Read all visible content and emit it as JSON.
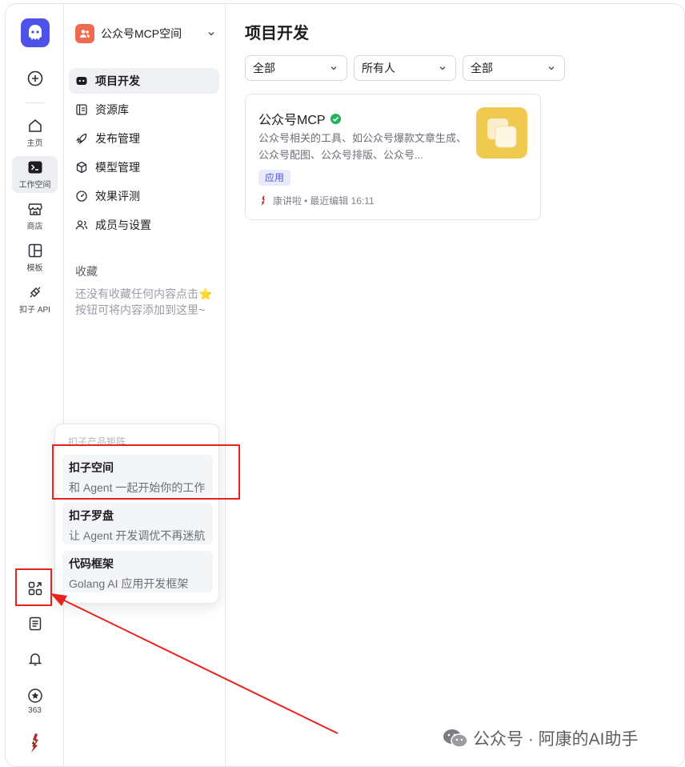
{
  "space": {
    "name": "公众号MCP空间"
  },
  "rail": {
    "create_label": "",
    "items": [
      {
        "label": "主页",
        "icon": "home-icon"
      },
      {
        "label": "工作空间",
        "icon": "terminal-icon",
        "active": true
      },
      {
        "label": "商店",
        "icon": "store-icon"
      },
      {
        "label": "模板",
        "icon": "template-icon"
      },
      {
        "label": "扣子 API",
        "icon": "api-icon"
      }
    ],
    "bottom": {
      "points": "363"
    }
  },
  "nav": {
    "items": [
      {
        "label": "项目开发",
        "icon": "bot-icon",
        "active": true
      },
      {
        "label": "资源库",
        "icon": "library-icon"
      },
      {
        "label": "发布管理",
        "icon": "rocket-icon"
      },
      {
        "label": "模型管理",
        "icon": "cube-icon"
      },
      {
        "label": "效果评测",
        "icon": "gauge-icon"
      },
      {
        "label": "成员与设置",
        "icon": "members-icon"
      }
    ],
    "favorites_title": "收藏",
    "favorites_empty": "还没有收藏任何内容点击⭐按钮可将内容添加到这里~"
  },
  "main": {
    "title": "项目开发",
    "filters": [
      "全部",
      "所有人",
      "全部"
    ],
    "card": {
      "title": "公众号MCP",
      "description": "公众号相关的工具、如公众号爆款文章生成、公众号配图、公众号排版、公众号...",
      "tag": "应用",
      "author": "康讲啦",
      "edited": "最近编辑 16:11"
    }
  },
  "popup": {
    "title": "扣子产品矩阵",
    "items": [
      {
        "name": "扣子空间",
        "desc": "和 Agent 一起开始你的工作"
      },
      {
        "name": "扣子罗盘",
        "desc": "让 Agent 开发调优不再迷航"
      },
      {
        "name": "代码框架",
        "desc": "Golang AI 应用开发框架"
      }
    ]
  },
  "watermark": "公众号 · 阿康的AI助手",
  "colors": {
    "accent": "#4d53e8",
    "highlight": "#e8231d",
    "verified": "#22b35e"
  }
}
